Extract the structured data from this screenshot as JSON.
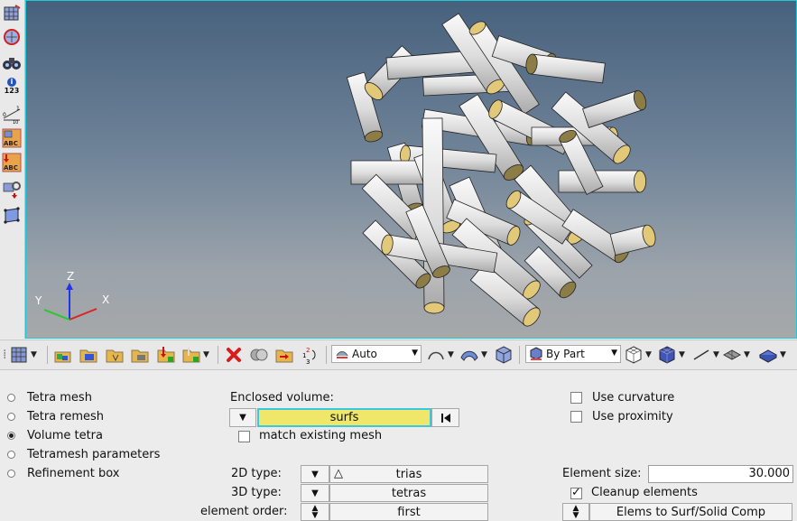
{
  "left_toolbar": {
    "icons": [
      "mesh-view-icon",
      "circle-mesh-icon",
      "binoculars-icon",
      "info-123-icon",
      "ruler-scale-icon",
      "abc-label-icon",
      "abc-arrow-icon",
      "gear-arrow-icon",
      "rectangle-select-icon"
    ],
    "info_label": "123",
    "scale_label_1": "0",
    "scale_label_2": "1",
    "scale_label_3": "10"
  },
  "viewport": {
    "triad": {
      "x": "X",
      "y": "Y",
      "z": "Z"
    },
    "colors": {
      "cylinder": "#e8e8e8",
      "cap": "#e2c97a",
      "cap_dark": "#8c7c45"
    }
  },
  "toolbar": {
    "display_mode": "Auto",
    "color_mode": "By Part"
  },
  "panel": {
    "options": [
      {
        "label": "Tetra mesh",
        "selected": false
      },
      {
        "label": "Tetra remesh",
        "selected": false
      },
      {
        "label": "Volume tetra",
        "selected": true
      },
      {
        "label": "Tetramesh parameters",
        "selected": false
      },
      {
        "label": "Refinement box",
        "selected": false
      }
    ],
    "enclosed_volume_label": "Enclosed volume:",
    "enclosed_volume_value": "surfs",
    "match_existing_mesh_label": "match existing mesh",
    "use_curvature_label": "Use curvature",
    "use_proximity_label": "Use proximity",
    "type_2d_label": "2D type:",
    "type_2d_value": "trias",
    "type_3d_label": "3D type:",
    "type_3d_value": "tetras",
    "element_order_label": "element order:",
    "element_order_value": "first",
    "element_size_label": "Element size:",
    "element_size_value": "30.000",
    "cleanup_label": "Cleanup elements",
    "elems_to_label": "Elems to Surf/Solid Comp"
  }
}
